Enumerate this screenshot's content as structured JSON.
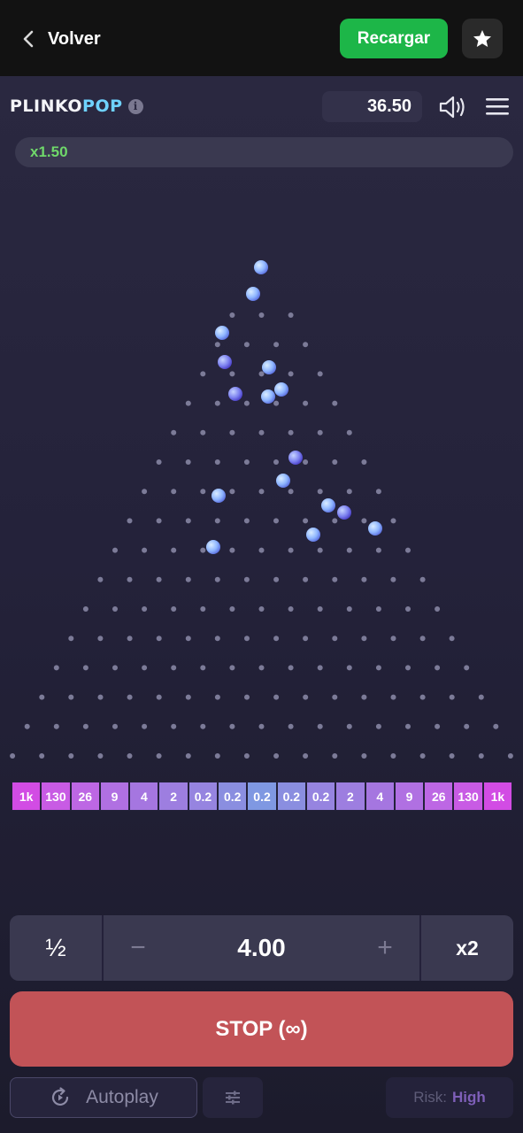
{
  "header": {
    "back_label": "Volver",
    "reload_label": "Recargar"
  },
  "game": {
    "logo_part1": "PLINKO",
    "logo_part2": "POP",
    "balance": "36.50",
    "history": [
      "x1.50"
    ],
    "multipliers": [
      "1k",
      "130",
      "26",
      "9",
      "4",
      "2",
      "0.2",
      "0.2",
      "0.2",
      "0.2",
      "0.2",
      "2",
      "4",
      "9",
      "26",
      "130",
      "1k"
    ],
    "multiplier_colors": [
      "#d24ce4",
      "#c85be4",
      "#bd67e4",
      "#b070e2",
      "#a576e0",
      "#9d7ee0",
      "#9684e0",
      "#8a8ee0",
      "#7f98e2",
      "#8a8ee0",
      "#9684e0",
      "#9d7ee0",
      "#a576e0",
      "#b070e2",
      "#bd67e4",
      "#c85be4",
      "#d24ce4"
    ],
    "bet_half_label": "½",
    "bet_minus_label": "−",
    "bet_amount": "4.00",
    "bet_plus_label": "+",
    "bet_double_label": "x2",
    "stop_label": "STOP (∞)",
    "autoplay_label": "Autoplay",
    "risk_label": "Risk:",
    "risk_value": "High"
  },
  "colors": {
    "reload_green": "#1db648",
    "stop_red": "#c25357",
    "history_green": "#6fd86a",
    "logo_accent": "#6fd2ff"
  },
  "icons": [
    "chevron-left-icon",
    "star-icon",
    "info-icon",
    "speaker-icon",
    "hamburger-menu-icon",
    "autoplay-icon",
    "sliders-icon"
  ]
}
